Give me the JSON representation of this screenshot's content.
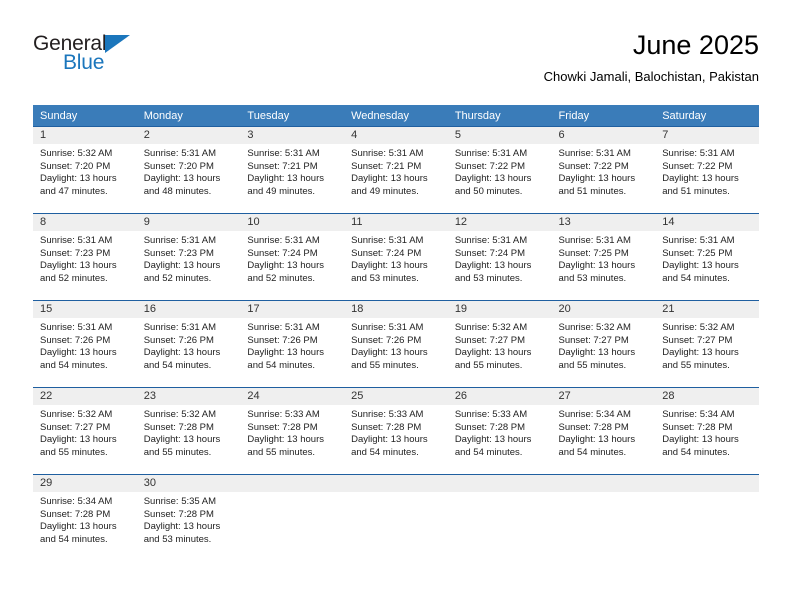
{
  "brand": {
    "name_part1": "General",
    "name_part2": "Blue",
    "accent_color": "#1b76bc"
  },
  "header": {
    "title": "June 2025",
    "subtitle": "Chowki Jamali, Balochistan, Pakistan"
  },
  "calendar": {
    "header_bg": "#3a7cb9",
    "divider_color": "#1f5fa0",
    "daynum_bg": "#efefef",
    "weekdays": [
      "Sunday",
      "Monday",
      "Tuesday",
      "Wednesday",
      "Thursday",
      "Friday",
      "Saturday"
    ],
    "weeks": [
      [
        {
          "day": "1",
          "sunrise": "Sunrise: 5:32 AM",
          "sunset": "Sunset: 7:20 PM",
          "daylight_line1": "Daylight: 13 hours",
          "daylight_line2": "and 47 minutes."
        },
        {
          "day": "2",
          "sunrise": "Sunrise: 5:31 AM",
          "sunset": "Sunset: 7:20 PM",
          "daylight_line1": "Daylight: 13 hours",
          "daylight_line2": "and 48 minutes."
        },
        {
          "day": "3",
          "sunrise": "Sunrise: 5:31 AM",
          "sunset": "Sunset: 7:21 PM",
          "daylight_line1": "Daylight: 13 hours",
          "daylight_line2": "and 49 minutes."
        },
        {
          "day": "4",
          "sunrise": "Sunrise: 5:31 AM",
          "sunset": "Sunset: 7:21 PM",
          "daylight_line1": "Daylight: 13 hours",
          "daylight_line2": "and 49 minutes."
        },
        {
          "day": "5",
          "sunrise": "Sunrise: 5:31 AM",
          "sunset": "Sunset: 7:22 PM",
          "daylight_line1": "Daylight: 13 hours",
          "daylight_line2": "and 50 minutes."
        },
        {
          "day": "6",
          "sunrise": "Sunrise: 5:31 AM",
          "sunset": "Sunset: 7:22 PM",
          "daylight_line1": "Daylight: 13 hours",
          "daylight_line2": "and 51 minutes."
        },
        {
          "day": "7",
          "sunrise": "Sunrise: 5:31 AM",
          "sunset": "Sunset: 7:22 PM",
          "daylight_line1": "Daylight: 13 hours",
          "daylight_line2": "and 51 minutes."
        }
      ],
      [
        {
          "day": "8",
          "sunrise": "Sunrise: 5:31 AM",
          "sunset": "Sunset: 7:23 PM",
          "daylight_line1": "Daylight: 13 hours",
          "daylight_line2": "and 52 minutes."
        },
        {
          "day": "9",
          "sunrise": "Sunrise: 5:31 AM",
          "sunset": "Sunset: 7:23 PM",
          "daylight_line1": "Daylight: 13 hours",
          "daylight_line2": "and 52 minutes."
        },
        {
          "day": "10",
          "sunrise": "Sunrise: 5:31 AM",
          "sunset": "Sunset: 7:24 PM",
          "daylight_line1": "Daylight: 13 hours",
          "daylight_line2": "and 52 minutes."
        },
        {
          "day": "11",
          "sunrise": "Sunrise: 5:31 AM",
          "sunset": "Sunset: 7:24 PM",
          "daylight_line1": "Daylight: 13 hours",
          "daylight_line2": "and 53 minutes."
        },
        {
          "day": "12",
          "sunrise": "Sunrise: 5:31 AM",
          "sunset": "Sunset: 7:24 PM",
          "daylight_line1": "Daylight: 13 hours",
          "daylight_line2": "and 53 minutes."
        },
        {
          "day": "13",
          "sunrise": "Sunrise: 5:31 AM",
          "sunset": "Sunset: 7:25 PM",
          "daylight_line1": "Daylight: 13 hours",
          "daylight_line2": "and 53 minutes."
        },
        {
          "day": "14",
          "sunrise": "Sunrise: 5:31 AM",
          "sunset": "Sunset: 7:25 PM",
          "daylight_line1": "Daylight: 13 hours",
          "daylight_line2": "and 54 minutes."
        }
      ],
      [
        {
          "day": "15",
          "sunrise": "Sunrise: 5:31 AM",
          "sunset": "Sunset: 7:26 PM",
          "daylight_line1": "Daylight: 13 hours",
          "daylight_line2": "and 54 minutes."
        },
        {
          "day": "16",
          "sunrise": "Sunrise: 5:31 AM",
          "sunset": "Sunset: 7:26 PM",
          "daylight_line1": "Daylight: 13 hours",
          "daylight_line2": "and 54 minutes."
        },
        {
          "day": "17",
          "sunrise": "Sunrise: 5:31 AM",
          "sunset": "Sunset: 7:26 PM",
          "daylight_line1": "Daylight: 13 hours",
          "daylight_line2": "and 54 minutes."
        },
        {
          "day": "18",
          "sunrise": "Sunrise: 5:31 AM",
          "sunset": "Sunset: 7:26 PM",
          "daylight_line1": "Daylight: 13 hours",
          "daylight_line2": "and 55 minutes."
        },
        {
          "day": "19",
          "sunrise": "Sunrise: 5:32 AM",
          "sunset": "Sunset: 7:27 PM",
          "daylight_line1": "Daylight: 13 hours",
          "daylight_line2": "and 55 minutes."
        },
        {
          "day": "20",
          "sunrise": "Sunrise: 5:32 AM",
          "sunset": "Sunset: 7:27 PM",
          "daylight_line1": "Daylight: 13 hours",
          "daylight_line2": "and 55 minutes."
        },
        {
          "day": "21",
          "sunrise": "Sunrise: 5:32 AM",
          "sunset": "Sunset: 7:27 PM",
          "daylight_line1": "Daylight: 13 hours",
          "daylight_line2": "and 55 minutes."
        }
      ],
      [
        {
          "day": "22",
          "sunrise": "Sunrise: 5:32 AM",
          "sunset": "Sunset: 7:27 PM",
          "daylight_line1": "Daylight: 13 hours",
          "daylight_line2": "and 55 minutes."
        },
        {
          "day": "23",
          "sunrise": "Sunrise: 5:32 AM",
          "sunset": "Sunset: 7:28 PM",
          "daylight_line1": "Daylight: 13 hours",
          "daylight_line2": "and 55 minutes."
        },
        {
          "day": "24",
          "sunrise": "Sunrise: 5:33 AM",
          "sunset": "Sunset: 7:28 PM",
          "daylight_line1": "Daylight: 13 hours",
          "daylight_line2": "and 55 minutes."
        },
        {
          "day": "25",
          "sunrise": "Sunrise: 5:33 AM",
          "sunset": "Sunset: 7:28 PM",
          "daylight_line1": "Daylight: 13 hours",
          "daylight_line2": "and 54 minutes."
        },
        {
          "day": "26",
          "sunrise": "Sunrise: 5:33 AM",
          "sunset": "Sunset: 7:28 PM",
          "daylight_line1": "Daylight: 13 hours",
          "daylight_line2": "and 54 minutes."
        },
        {
          "day": "27",
          "sunrise": "Sunrise: 5:34 AM",
          "sunset": "Sunset: 7:28 PM",
          "daylight_line1": "Daylight: 13 hours",
          "daylight_line2": "and 54 minutes."
        },
        {
          "day": "28",
          "sunrise": "Sunrise: 5:34 AM",
          "sunset": "Sunset: 7:28 PM",
          "daylight_line1": "Daylight: 13 hours",
          "daylight_line2": "and 54 minutes."
        }
      ],
      [
        {
          "day": "29",
          "sunrise": "Sunrise: 5:34 AM",
          "sunset": "Sunset: 7:28 PM",
          "daylight_line1": "Daylight: 13 hours",
          "daylight_line2": "and 54 minutes."
        },
        {
          "day": "30",
          "sunrise": "Sunrise: 5:35 AM",
          "sunset": "Sunset: 7:28 PM",
          "daylight_line1": "Daylight: 13 hours",
          "daylight_line2": "and 53 minutes."
        },
        {
          "day": "",
          "sunrise": "",
          "sunset": "",
          "daylight_line1": "",
          "daylight_line2": ""
        },
        {
          "day": "",
          "sunrise": "",
          "sunset": "",
          "daylight_line1": "",
          "daylight_line2": ""
        },
        {
          "day": "",
          "sunrise": "",
          "sunset": "",
          "daylight_line1": "",
          "daylight_line2": ""
        },
        {
          "day": "",
          "sunrise": "",
          "sunset": "",
          "daylight_line1": "",
          "daylight_line2": ""
        },
        {
          "day": "",
          "sunrise": "",
          "sunset": "",
          "daylight_line1": "",
          "daylight_line2": ""
        }
      ]
    ]
  }
}
